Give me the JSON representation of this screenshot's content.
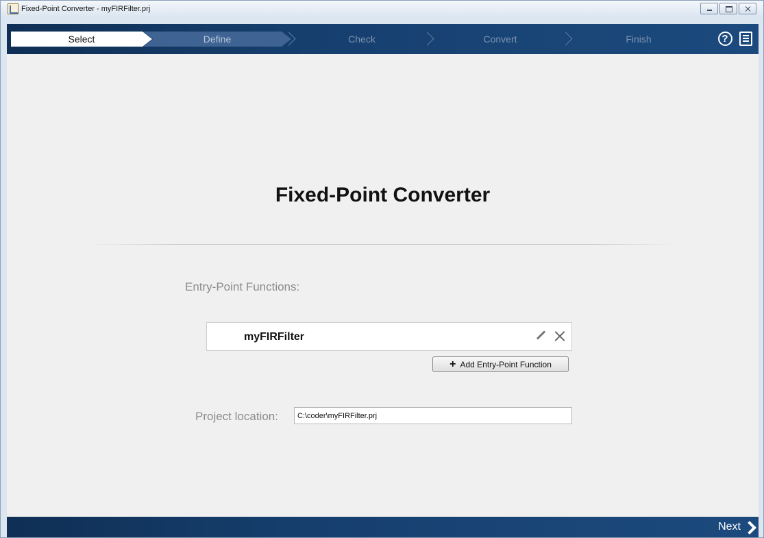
{
  "window": {
    "title": "Fixed-Point Converter - myFIRFilter.prj",
    "icon": "fixed-point-converter-app-icon",
    "controls": [
      "minimize-icon",
      "maximize-icon",
      "close-icon"
    ]
  },
  "workflow": {
    "steps": [
      {
        "label": "Select",
        "state": "active"
      },
      {
        "label": "Define",
        "state": "next"
      },
      {
        "label": "Check",
        "state": "inactive"
      },
      {
        "label": "Convert",
        "state": "inactive"
      },
      {
        "label": "Finish",
        "state": "inactive"
      }
    ],
    "help_icon": "help-icon",
    "menu_icon": "menu-icon"
  },
  "main": {
    "title": "Fixed-Point Converter",
    "entry_points_label": "Entry-Point Functions:",
    "entry_points": [
      {
        "name": "myFIRFilter",
        "edit_icon": "pencil-icon",
        "remove_icon": "close-icon"
      }
    ],
    "add_button_label": "Add Entry-Point Function",
    "project_location_label": "Project location:",
    "project_location_value": "C:\\coder\\myFIRFilter.prj"
  },
  "footer": {
    "next_label": "Next"
  },
  "colors": {
    "bar_dark": "#0f2f55",
    "bar_light": "#1c4a7e",
    "define_step": "#3f6393",
    "content_bg": "#f0f0f0"
  }
}
